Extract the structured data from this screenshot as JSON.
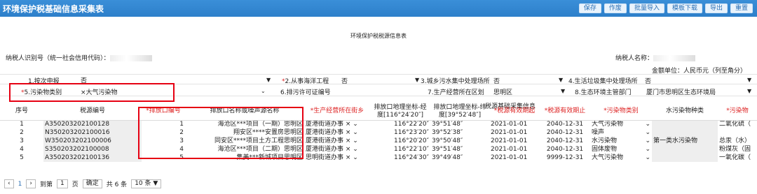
{
  "title": "环境保护税基础信息采集表",
  "toolbar": [
    "保存",
    "作废",
    "批量导入",
    "模板下载",
    "导出",
    "重置"
  ],
  "subtitle": "环境保护税税源信息表",
  "taxpayer_id_label": "纳税人识别号（统一社会信用代码）：",
  "taxpayer_name_label": "纳税人名称：",
  "unit": "金额单位：人民币元（列至角分）",
  "q1_label": "1.按次申报",
  "q1_value": "否",
  "q2_label": "2.从事海洋工程",
  "q2_value": "否",
  "q3_label": "3.城乡污水集中处理场所",
  "q3_value": "否",
  "q4_label": "4.生活垃圾集中处理场所",
  "q4_value": "否",
  "q5_label": "5.污染物类别",
  "q5_value": "×大气污染物",
  "q6_label": "6.排污许可证编号",
  "q7_label": "7.生产经营所在区划",
  "q7_value": "思明区",
  "q8_label": "8.生态环境主管部门",
  "q8_value": "厦门市思明区生态环境局",
  "group_header": "税源基础采集信息",
  "columns": [
    "序号",
    "税源编号",
    "*排放口编号",
    "排放口名称或噪声源名称",
    "*生产经营所在街乡",
    "排放口地理坐标-经度[116°24′20″]",
    "排放口地理坐标-纬度[39°52′48″]",
    "*税源有效期起",
    "*税源有效期止",
    "*污染物类别",
    "水污染物种类",
    "*污染物"
  ],
  "rows": [
    {
      "no": "1",
      "code": "A350203202100128",
      "outlet": "1",
      "name": "海沧区***项目（一期）思明区",
      "street": "厦港街道办事",
      "lng": "116°22′20″",
      "lat": "39°51′48″",
      "start": "2021-01-01",
      "end": "2040-12-31",
      "cat": "大气污染物",
      "water": "",
      "pol": "二氧化硫（"
    },
    {
      "no": "2",
      "code": "N350203202100016",
      "outlet": "2",
      "name": "翔安区****安置房思明区",
      "street": "厦港街道办事",
      "lng": "116°23′20″",
      "lat": "39°52′38″",
      "start": "2021-01-01",
      "end": "2040-12-31",
      "cat": "噪声",
      "water": "",
      "pol": ""
    },
    {
      "no": "3",
      "code": "W350203202100006",
      "outlet": "3",
      "name": "同安区****项目土方工程思明区",
      "street": "厦港街道办事",
      "lng": "116°20′20″",
      "lat": "39°50′48″",
      "start": "2021-01-01",
      "end": "2040-12-31",
      "cat": "水污染物",
      "water": "第一类水污染物",
      "pol": "总汞（水）"
    },
    {
      "no": "4",
      "code": "S350203202100008",
      "outlet": "4",
      "name": "海沧区***项目（二期）思明区",
      "street": "厦港街道办事",
      "lng": "116°22′10″",
      "lat": "39°51′48″",
      "start": "2021-01-01",
      "end": "2040-12-31",
      "cat": "固体废物",
      "water": "",
      "pol": "粉煤灰（固"
    },
    {
      "no": "5",
      "code": "A350203202100136",
      "outlet": "5",
      "name": "集美***新城项目思明区",
      "street": "思明街道办事",
      "lng": "116°24′30″",
      "lat": "39°49′48″",
      "start": "2021-01-01",
      "end": "9999-12-31",
      "cat": "大气污染物",
      "water": "",
      "pol": "一氧化碳（"
    }
  ],
  "pager": {
    "page": "1",
    "goto": "到第",
    "page_input": "1",
    "page_unit": "页",
    "confirm": "确定",
    "total": "共 6 条",
    "size": "10 条"
  },
  "colors": {
    "title_bar": "#2d7fca",
    "highlight": "#e60012"
  }
}
